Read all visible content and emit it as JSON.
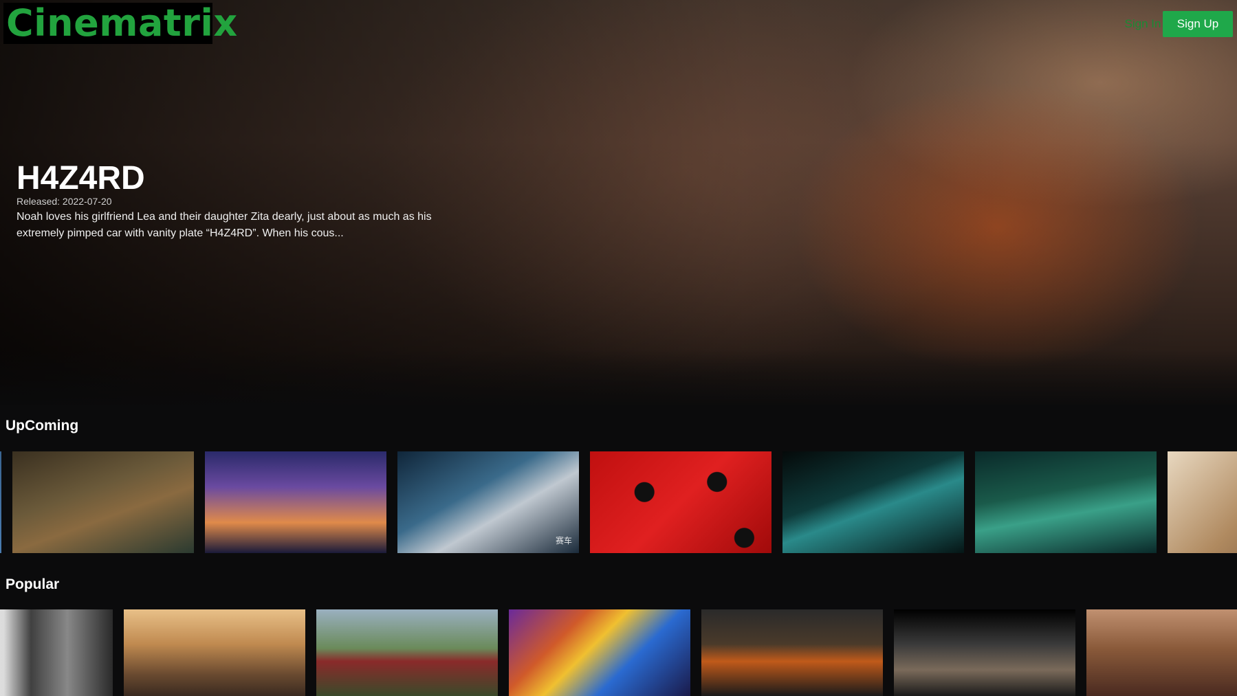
{
  "app": {
    "logo": "Cinematrix"
  },
  "nav": {
    "sign_in": "Sign In",
    "sign_up": "Sign Up"
  },
  "colors": {
    "brand": "#22a33e",
    "button": "#1fa84a",
    "background": "#0b0b0c"
  },
  "hero": {
    "title": "H4Z4RD",
    "released": "Released: 2022-07-20",
    "description": "Noah loves his girlfriend Lea and their daughter Zita dearly, just about as much as his extremely pimped car with vanity plate “H4Z4RD”. When his cous..."
  },
  "rows": [
    {
      "title": "UpComing",
      "cards": [
        {
          "name": "upcoming-card-0",
          "bg": "linear-gradient(135deg,#1e3a5a,#4a7cb0)"
        },
        {
          "name": "upcoming-card-1",
          "bg": "linear-gradient(160deg,#3a3020 0%,#6b5a3a 40%,#8a6a40 60%,#2a3a30 100%)"
        },
        {
          "name": "upcoming-card-2",
          "bg": "linear-gradient(180deg,#2a2a6a 0%,#6a4aa0 35%,#e08a4a 70%,#1a1a3a 100%)"
        },
        {
          "name": "upcoming-card-3",
          "bg": "linear-gradient(150deg,#10263a 0%,#3a6a8a 40%,#c0c8d0 60%,#1a2a3a 100%)",
          "label": "赛车"
        },
        {
          "name": "upcoming-card-4",
          "bg": "radial-gradient(circle at 30% 40%,#101010 0 14px,rgba(0,0,0,0) 15px),radial-gradient(circle at 70% 30%,#101010 0 14px,rgba(0,0,0,0) 15px),radial-gradient(circle at 85% 85%,#101010 0 14px,rgba(0,0,0,0) 15px),linear-gradient(135deg,#c01010,#e02020 50%,#a00a0a)"
        },
        {
          "name": "upcoming-card-5",
          "bg": "linear-gradient(160deg,#050a0a 0%,#0e3a3a 40%,#2a8a8a 55%,#051515 100%)"
        },
        {
          "name": "upcoming-card-6",
          "bg": "linear-gradient(170deg,#0a2a2a 0%,#1a5a4a 40%,#3aa088 60%,#0a2a2a 100%)"
        },
        {
          "name": "upcoming-card-7",
          "bg": "linear-gradient(135deg,#e8d8c0,#b08a60 50%,#6a4a30)"
        }
      ]
    },
    {
      "title": "Popular",
      "cards": [
        {
          "name": "popular-card-0",
          "bg": "linear-gradient(90deg,#f2f2f2 0%,#dcdcdc 40%,#404040 55%,#888 75%,#2a2a2a 100%)"
        },
        {
          "name": "popular-card-1",
          "bg": "linear-gradient(180deg,#e8c088 0%,#c08a50 40%,#6a4a30 75%,#3a2a20 100%)"
        },
        {
          "name": "popular-card-2",
          "bg": "linear-gradient(180deg,#9ab0c0 0%,#6a8a5a 45%,#8a2a2a 60%,#3a4a2a 100%)"
        },
        {
          "name": "popular-card-3",
          "bg": "linear-gradient(135deg,#6a2a9a 0%,#d05a2a 30%,#f0c030 45%,#2a6ad0 65%,#1a1a4a 100%)"
        },
        {
          "name": "popular-card-4",
          "bg": "linear-gradient(180deg,#2a2a2a 0%,#4a3a2a 40%,#c05a1a 60%,#1a1a1a 100%)"
        },
        {
          "name": "popular-card-5",
          "bg": "linear-gradient(180deg,#000 0%,#3a3a3a 40%,#7a6a5a 70%,#1a1a1a 100%)"
        },
        {
          "name": "popular-card-6",
          "bg": "linear-gradient(180deg,#c09070 0%,#8a5a3a 45%,#4a2a20 100%)"
        }
      ]
    }
  ]
}
